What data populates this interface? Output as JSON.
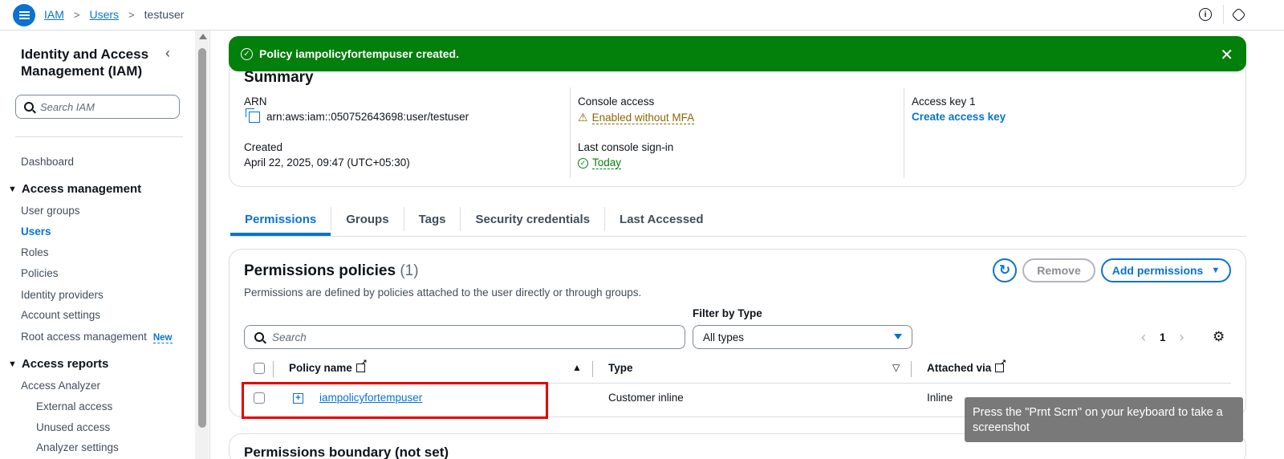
{
  "breadcrumb": {
    "items": [
      "IAM",
      "Users"
    ],
    "current": "testuser"
  },
  "sidebar": {
    "title": "Identity and Access Management (IAM)",
    "search_placeholder": "Search IAM",
    "dashboard": "Dashboard",
    "access_management": {
      "heading": "Access management",
      "items": [
        "User groups",
        "Users",
        "Roles",
        "Policies",
        "Identity providers",
        "Account settings",
        "Root access management"
      ],
      "new_badge": "New"
    },
    "access_reports": {
      "heading": "Access reports",
      "items": [
        "Access Analyzer"
      ],
      "sub_items": [
        "External access",
        "Unused access",
        "Analyzer settings"
      ]
    }
  },
  "flash": {
    "message": "Policy iampolicyfortempuser created."
  },
  "summary": {
    "title": "Summary",
    "arn_label": "ARN",
    "arn_value": "arn:aws:iam::050752643698:user/testuser",
    "created_label": "Created",
    "created_value": "April 22, 2025, 09:47 (UTC+05:30)",
    "console_label": "Console access",
    "console_value": "Enabled without MFA",
    "signin_label": "Last console sign-in",
    "signin_value": "Today",
    "key_label": "Access key 1",
    "key_link": "Create access key"
  },
  "tabs": [
    "Permissions",
    "Groups",
    "Tags",
    "Security credentials",
    "Last Accessed"
  ],
  "permissions": {
    "title": "Permissions policies",
    "count": "(1)",
    "description": "Permissions are defined by policies attached to the user directly or through groups.",
    "remove_label": "Remove",
    "add_label": "Add permissions",
    "filter_label": "Filter by Type",
    "search_placeholder": "Search",
    "filter_value": "All types",
    "page": "1",
    "columns": [
      "Policy name",
      "Type",
      "Attached via"
    ],
    "rows": [
      {
        "name": "iampolicyfortempuser",
        "type": "Customer inline",
        "attached": "Inline"
      }
    ]
  },
  "bottom_section": {
    "title": "Permissions boundary (not set)"
  },
  "tooltip": "Press the \"Prnt Scrn\" on your keyboard to take a screenshot",
  "colors": {
    "accent": "#0972d3",
    "success": "#037f0c",
    "warning": "#8d6605",
    "highlight": "#e60000"
  }
}
